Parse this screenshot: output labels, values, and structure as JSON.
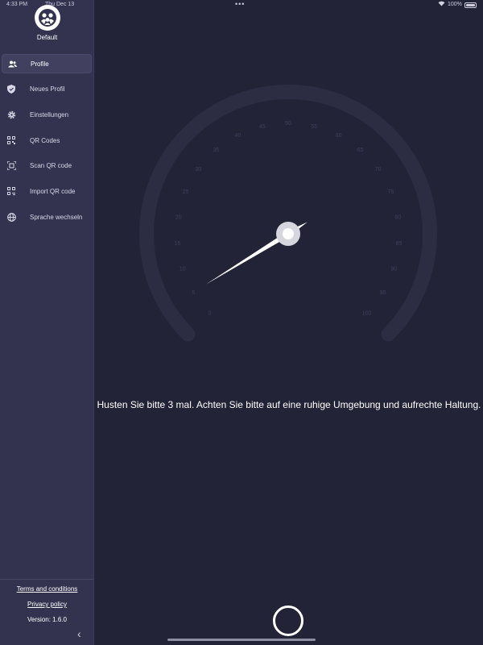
{
  "status_bar": {
    "time": "4:33 PM",
    "date": "Thu Dec 13",
    "dots": "•••",
    "battery": "100%"
  },
  "sidebar": {
    "profile_name": "Default",
    "items": [
      {
        "label": "Profile",
        "icon": "users-icon",
        "active": true
      },
      {
        "label": "Neues Profil",
        "icon": "shield-icon",
        "active": false
      },
      {
        "label": "Einstellungen",
        "icon": "gear-icon",
        "active": false
      },
      {
        "label": "QR Codes",
        "icon": "qr-code-icon",
        "active": false
      },
      {
        "label": "Scan QR code",
        "icon": "scan-icon",
        "active": false
      },
      {
        "label": "Import QR code",
        "icon": "qr-import-icon",
        "active": false
      },
      {
        "label": "Sprache wechseln",
        "icon": "globe-icon",
        "active": false
      }
    ],
    "footer": {
      "terms": "Terms and conditions",
      "privacy": "Privacy policy",
      "version": "Version: 1.6.0"
    }
  },
  "gauge": {
    "ticks": [
      "0",
      "5",
      "10",
      "15",
      "20",
      "25",
      "30",
      "35",
      "40",
      "45",
      "50",
      "55",
      "60",
      "65",
      "70",
      "75",
      "80",
      "85",
      "90",
      "95",
      "100"
    ],
    "needle_value": 5,
    "min": 0,
    "max": 100
  },
  "main": {
    "instruction": "Husten Sie bitte 3 mal. Achten Sie bitte auf eine ruhige Umgebung und aufrechte Haltung."
  },
  "colors": {
    "background": "#232338",
    "sidebar": "#333350",
    "gauge_track": "#2c2c42",
    "needle": "#ffffff"
  }
}
